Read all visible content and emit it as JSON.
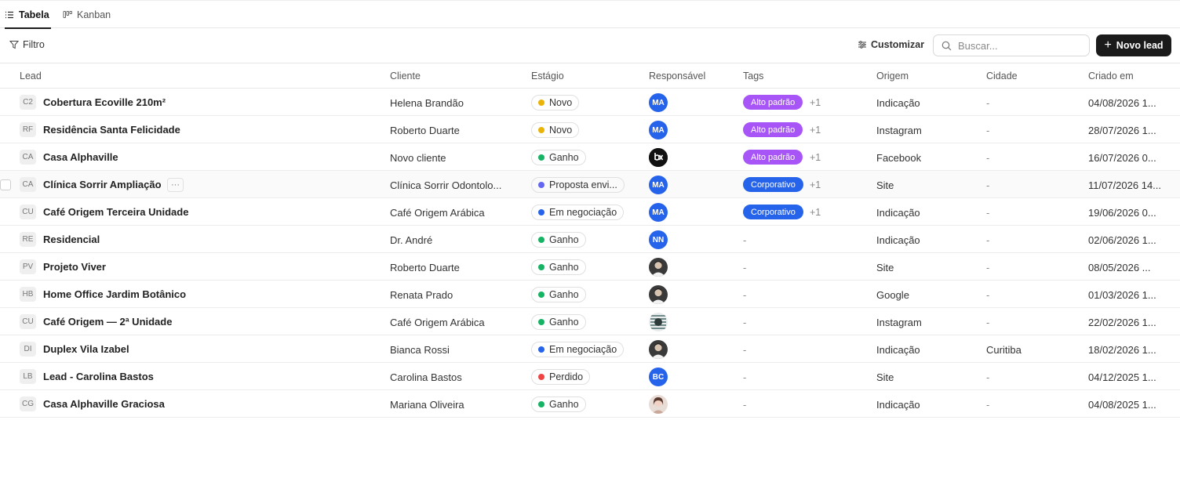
{
  "tabs": [
    {
      "label": "Tabela",
      "icon": "list-icon",
      "active": true
    },
    {
      "label": "Kanban",
      "icon": "kanban-icon",
      "active": false
    }
  ],
  "toolbar": {
    "filter_label": "Filtro",
    "customize_label": "Customizar",
    "search_placeholder": "Buscar...",
    "new_lead_label": "Novo lead"
  },
  "columns": [
    "Lead",
    "Cliente",
    "Estágio",
    "Responsável",
    "Tags",
    "Origem",
    "Cidade",
    "Criado em"
  ],
  "colors": {
    "stage_novo": "#eab308",
    "stage_ganho": "#16b364",
    "stage_proposta": "#6366f1",
    "stage_negociacao": "#2563eb",
    "stage_perdido": "#ef4444",
    "tag_alto_padrao": "#a855f7",
    "tag_corporativo": "#2563eb",
    "avatar_blue": "#2563eb",
    "primary_button": "#1b1b1b"
  },
  "rows": [
    {
      "abbr": "C2",
      "lead": "Cobertura Ecoville 210m²",
      "client": "Helena Brandão",
      "stage": "Novo",
      "stage_color": "#eab308",
      "owner": "MA",
      "owner_type": "initials",
      "tag": "Alto padrão",
      "tag_color": "#a855f7",
      "tag_more": "+1",
      "origin": "Indicação",
      "city": "-",
      "created": "04/08/2026 1..."
    },
    {
      "abbr": "RF",
      "lead": "Residência Santa Felicidade",
      "client": "Roberto Duarte",
      "stage": "Novo",
      "stage_color": "#eab308",
      "owner": "MA",
      "owner_type": "initials",
      "tag": "Alto padrão",
      "tag_color": "#a855f7",
      "tag_more": "+1",
      "origin": "Instagram",
      "city": "-",
      "created": "28/07/2026 1..."
    },
    {
      "abbr": "CA",
      "lead": "Casa Alphaville",
      "client": "Novo cliente",
      "stage": "Ganho",
      "stage_color": "#16b364",
      "owner": "bx",
      "owner_type": "logo",
      "tag": "Alto padrão",
      "tag_color": "#a855f7",
      "tag_more": "+1",
      "origin": "Facebook",
      "city": "-",
      "created": "16/07/2026 0..."
    },
    {
      "abbr": "CA",
      "lead": "Clínica Sorrir Ampliação",
      "client": "Clínica Sorrir Odontolo...",
      "stage": "Proposta envi...",
      "stage_color": "#6366f1",
      "owner": "MA",
      "owner_type": "initials",
      "tag": "Corporativo",
      "tag_color": "#2563eb",
      "tag_more": "+1",
      "origin": "Site",
      "city": "-",
      "created": "11/07/2026 14...",
      "hover": true
    },
    {
      "abbr": "CU",
      "lead": "Café Origem Terceira Unidade",
      "client": "Café Origem Arábica",
      "stage": "Em negociação",
      "stage_color": "#2563eb",
      "owner": "MA",
      "owner_type": "initials",
      "tag": "Corporativo",
      "tag_color": "#2563eb",
      "tag_more": "+1",
      "origin": "Indicação",
      "city": "-",
      "created": "19/06/2026 0..."
    },
    {
      "abbr": "RE",
      "lead": "Residencial",
      "client": "Dr. André",
      "stage": "Ganho",
      "stage_color": "#16b364",
      "owner": "NN",
      "owner_type": "initials",
      "tag": "-",
      "tag_color": "",
      "tag_more": "",
      "origin": "Indicação",
      "city": "-",
      "created": "02/06/2026 1..."
    },
    {
      "abbr": "PV",
      "lead": "Projeto Viver",
      "client": "Roberto Duarte",
      "stage": "Ganho",
      "stage_color": "#16b364",
      "owner": "",
      "owner_type": "photo-man",
      "tag": "-",
      "tag_color": "",
      "tag_more": "",
      "origin": "Site",
      "city": "-",
      "created": "08/05/2026 ..."
    },
    {
      "abbr": "HB",
      "lead": "Home Office Jardim Botânico",
      "client": "Renata Prado",
      "stage": "Ganho",
      "stage_color": "#16b364",
      "owner": "",
      "owner_type": "photo-man",
      "tag": "-",
      "tag_color": "",
      "tag_more": "",
      "origin": "Google",
      "city": "-",
      "created": "01/03/2026 1..."
    },
    {
      "abbr": "CU",
      "lead": "Café Origem — 2ª Unidade",
      "client": "Café Origem Arábica",
      "stage": "Ganho",
      "stage_color": "#16b364",
      "owner": "",
      "owner_type": "photo-pattern",
      "tag": "-",
      "tag_color": "",
      "tag_more": "",
      "origin": "Instagram",
      "city": "-",
      "created": "22/02/2026 1..."
    },
    {
      "abbr": "DI",
      "lead": "Duplex Vila Izabel",
      "client": "Bianca Rossi",
      "stage": "Em negociação",
      "stage_color": "#2563eb",
      "owner": "",
      "owner_type": "photo-man",
      "tag": "-",
      "tag_color": "",
      "tag_more": "",
      "origin": "Indicação",
      "city": "Curitiba",
      "created": "18/02/2026 1..."
    },
    {
      "abbr": "LB",
      "lead": "Lead - Carolina Bastos",
      "client": "Carolina Bastos",
      "stage": "Perdido",
      "stage_color": "#ef4444",
      "owner": "BC",
      "owner_type": "initials",
      "tag": "-",
      "tag_color": "",
      "tag_more": "",
      "origin": "Site",
      "city": "-",
      "created": "04/12/2025 1..."
    },
    {
      "abbr": "CG",
      "lead": "Casa Alphaville Graciosa",
      "client": "Mariana Oliveira",
      "stage": "Ganho",
      "stage_color": "#16b364",
      "owner": "",
      "owner_type": "photo-woman",
      "tag": "-",
      "tag_color": "",
      "tag_more": "",
      "origin": "Indicação",
      "city": "-",
      "created": "04/08/2025 1..."
    }
  ],
  "row_actions": {
    "more_label": "···"
  }
}
